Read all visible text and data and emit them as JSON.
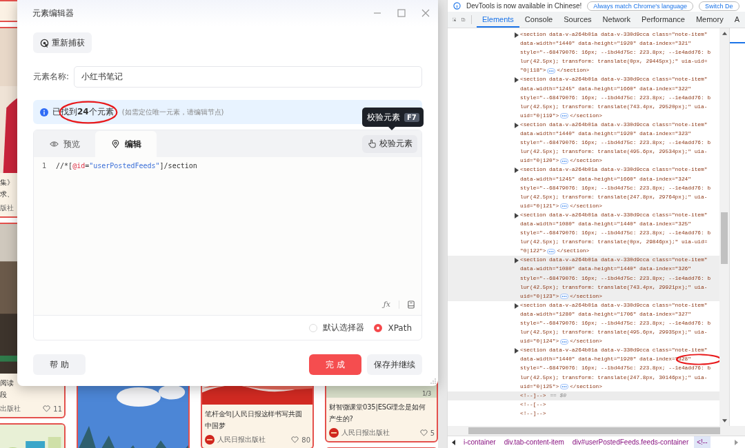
{
  "feed": {
    "columns": [
      {
        "cards": [
          {
            "kind": "blank"
          },
          {
            "kind": "note",
            "title_lines": [
              "集》",
              "求、"
            ],
            "avatar": false,
            "author": "版社"
          },
          {
            "kind": "note",
            "title_lines": [
              "阅读",
              "段"
            ],
            "avatar": false,
            "author": "出版社",
            "likes": "11"
          },
          {
            "kind": "cover"
          }
        ]
      },
      {
        "cards": [
          {
            "kind": "cover"
          }
        ]
      },
      {
        "cards": [
          {
            "kind": "note",
            "title_lines": [
              "笔杆金句|人民日报这样书写共圆",
              "中国梦"
            ],
            "avatar": true,
            "author": "人民日报出版社",
            "likes": "80"
          }
        ]
      },
      {
        "cards": [
          {
            "kind": "note",
            "image_counter": "1/3",
            "title_lines": [
              "财智微课堂035|ESG理念是如何",
              "产生的?"
            ],
            "avatar": true,
            "author": "人民日报出版社",
            "likes": "5"
          },
          {
            "kind": "blank"
          }
        ]
      }
    ]
  },
  "dialog": {
    "title": "元素编辑器",
    "recapture_button": "重新捕获",
    "name_label": "元素名称:",
    "name_value": "小红书笔记",
    "match_message": "已找到**24**个元素",
    "match_hint": "(如需定位唯一元素，请编辑节点)",
    "tooltip": {
      "text": "校验元素",
      "shortcut": "F7"
    },
    "tabs": [
      {
        "label": "预览",
        "selected": false
      },
      {
        "label": "编辑",
        "selected": true
      }
    ],
    "validate_button": "校验元素",
    "code_lines": [
      {
        "number": "1",
        "tokens": [
          {
            "kind": "plain",
            "text": "//*["
          },
          {
            "kind": "attr",
            "text": "@id"
          },
          {
            "kind": "plain",
            "text": "="
          },
          {
            "kind": "string",
            "text": "\"userPostedFeeds\""
          },
          {
            "kind": "plain",
            "text": "]/section"
          }
        ]
      }
    ],
    "formula_button": "ƒx",
    "selector_modes": [
      {
        "label": "默认选择器",
        "selected": false
      },
      {
        "label": "XPath",
        "selected": true
      }
    ],
    "help_button": "帮 助",
    "done_button": "完 成",
    "save_continue_button": "保存并继续"
  },
  "devtools": {
    "notice": {
      "message": "DevTools is now available in Chinese!",
      "buttons": [
        "Always match Chrome's language",
        "Switch De"
      ]
    },
    "tabs": [
      {
        "label": "Elements",
        "selected": true
      },
      {
        "label": "Console",
        "selected": false
      },
      {
        "label": "Sources",
        "selected": false
      },
      {
        "label": "Network",
        "selected": false
      },
      {
        "label": "Performance",
        "selected": false
      },
      {
        "label": "Memory",
        "selected": false
      },
      {
        "label": "A",
        "selected": false
      }
    ],
    "nodes": [
      {
        "expanded": false,
        "highlighted": false,
        "lines": [
          "<section data-v-a264b01a data-v-330d9cca class=\"note-item\"",
          "data-width=\"1440\" data-height=\"1920\" data-index=\"321\"",
          "style=\"--68479076: 16px; --1bd4d75c: 223.8px; --1e4add76: b",
          "lur(42.5px); transform: translate(0px, 29445px);\" uia-uid="
        ],
        "tail": "\"0|118\">",
        "close": "</section>"
      },
      {
        "expanded": false,
        "highlighted": false,
        "lines": [
          "<section data-v-a264b01a data-v-330d9cca class=\"note-item\"",
          "data-width=\"1245\" data-height=\"1660\" data-index=\"322\"",
          "style=\"--68479076: 16px; --1bd4d75c: 223.8px; --1e4add76: b",
          "lur(42.5px); transform: translate(743.4px, 29520px);\" uia-"
        ],
        "tail": "uid=\"0|119\">",
        "close": "</section>"
      },
      {
        "expanded": false,
        "highlighted": false,
        "lines": [
          "<section data-v-a264b01a data-v-330d9cca class=\"note-item\"",
          "data-width=\"1440\" data-height=\"1920\" data-index=\"323\"",
          "style=\"--68479076: 16px; --1bd4d75c: 223.8px; --1e4add76: b",
          "lur(42.5px); transform: translate(495.6px, 29534px);\" uia-"
        ],
        "tail": "uid=\"0|120\">",
        "close": "</section>"
      },
      {
        "expanded": false,
        "highlighted": false,
        "lines": [
          "<section data-v-a264b01a data-v-330d9cca class=\"note-item\"",
          "data-width=\"1245\" data-height=\"1660\" data-index=\"324\"",
          "style=\"--68479076: 16px; --1bd4d75c: 223.8px; --1e4add76: b",
          "lur(42.5px); transform: translate(247.8px, 29764px);\" uia-"
        ],
        "tail": "uid=\"0|121\">",
        "close": "</section>"
      },
      {
        "expanded": false,
        "highlighted": false,
        "lines": [
          "<section data-v-a264b01a data-v-330d9cca class=\"note-item\"",
          "data-width=\"1080\" data-height=\"1440\" data-index=\"325\"",
          "style=\"--68479076: 16px; --1bd4d75c: 223.8px; --1e4add76: b",
          "lur(42.5px); transform: translate(0px, 29846px);\" uia-uid="
        ],
        "tail": "\"0|122\">",
        "close": "</section>"
      },
      {
        "expanded": false,
        "highlighted": true,
        "lines": [
          "<section data-v-a264b01a data-v-330d9cca class=\"note-item\"",
          "data-width=\"1080\" data-height=\"1440\" data-index=\"326\"",
          "style=\"--68479076: 16px; --1bd4d75c: 223.8px; --1e4add76: b",
          "lur(42.5px); transform: translate(743.4px, 29921px);\" uia-"
        ],
        "tail": "uid=\"0|123\">",
        "close": "</section>"
      },
      {
        "expanded": false,
        "highlighted": false,
        "lines": [
          "<section data-v-a264b01a data-v-330d9cca class=\"note-item\"",
          "data-width=\"1280\" data-height=\"1706\" data-index=\"327\"",
          "style=\"--68479076: 16px; --1bd4d75c: 223.8px; --1e4add76: b",
          "lur(42.5px); transform: translate(495.6px, 29935px);\" uia-"
        ],
        "tail": "uid=\"0|124\">",
        "close": "</section>"
      },
      {
        "expanded": false,
        "highlighted": false,
        "lines": [
          "<section data-v-a264b01a data-v-330d9cca class=\"note-item\"",
          "data-width=\"1440\" data-height=\"1920\" data-index=\"328\"",
          "style=\"--68479076: 16px; --1bd4d75c: 223.8px; --1e4add76: b",
          "lur(42.5px); transform: translate(247.8px, 30146px);\" uia-"
        ],
        "tail": "uid=\"0|125\">",
        "close": "</section>"
      }
    ],
    "comments": [
      {
        "text": "<!--]-->",
        "suffix": "== $0",
        "selected": true
      },
      {
        "text": "<!--[-->",
        "selected": false
      },
      {
        "text": "<!--]-->",
        "selected": false
      }
    ],
    "breadcrumbs": [
      {
        "label": "i-container",
        "selected": false
      },
      {
        "label": "div.tab-content-item",
        "selected": false
      },
      {
        "label": "div#userPostedFeeds.feeds-container",
        "selected": false
      },
      {
        "label": "<!--",
        "selected": true
      }
    ]
  }
}
